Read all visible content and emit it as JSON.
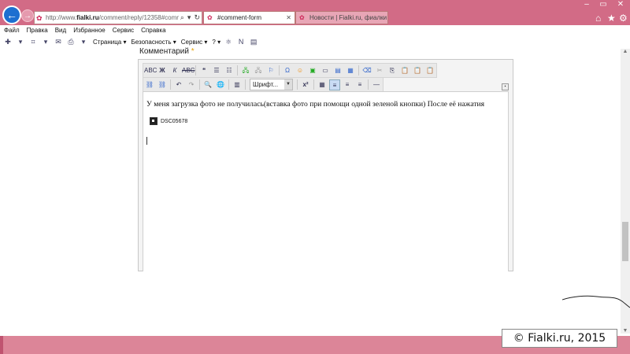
{
  "browser": {
    "address": {
      "url_prefix": "http://www.",
      "url_bold": "fialki.ru",
      "url_rest": "/comment/reply/12358#comment",
      "search_glyph": "⌕",
      "dropdown_glyph": "▾",
      "refresh_glyph": "↻"
    },
    "tabs": [
      {
        "label": "#comment-form",
        "active": true
      },
      {
        "label": "Новости | Fialki.ru, фиалки (с...",
        "active": false
      }
    ],
    "window_controls": {
      "minimize": "–",
      "maximize": "▭",
      "close": "✕"
    },
    "toolbar_icons": {
      "home": "⌂",
      "favorites": "★",
      "settings": "⚙"
    },
    "menu": [
      "Файл",
      "Правка",
      "Вид",
      "Избранное",
      "Сервис",
      "Справка"
    ],
    "commands": {
      "page": "Страница ▾",
      "security": "Безопасность ▾",
      "service": "Сервис ▾",
      "help": "? ▾"
    }
  },
  "form": {
    "label": "Комментарий",
    "required_mark": "*"
  },
  "editor": {
    "toolbar1": [
      "ABC",
      "Ж",
      "К",
      "ABC",
      "❝",
      "☰",
      "☷",
      "🖧",
      "🖧",
      "⚐",
      "Ω",
      "☺",
      "▣",
      "▭",
      "▤",
      "▦",
      "⌫",
      "✂",
      "⎘",
      "📋",
      "📋",
      "📋"
    ],
    "toolbar2": [
      "⛓",
      "⛓",
      "↶",
      "↷",
      "🔍",
      "🌐",
      "▥",
      "x²",
      "▦",
      "≡",
      "≡",
      "≡",
      "—"
    ],
    "font_select": "Шрифт...",
    "content_text": "У меня загрузка фото не получилась(вставка фото при помощи одной зеленой кнопки) После её нажатия",
    "attachment_name": "DSC05678"
  },
  "footer": {
    "copyright": "© Fialki.ru, 2015"
  },
  "colors": {
    "chrome_pink": "#d26b86",
    "back_button": "#1d6fd0",
    "required_star": "#e6a100"
  }
}
